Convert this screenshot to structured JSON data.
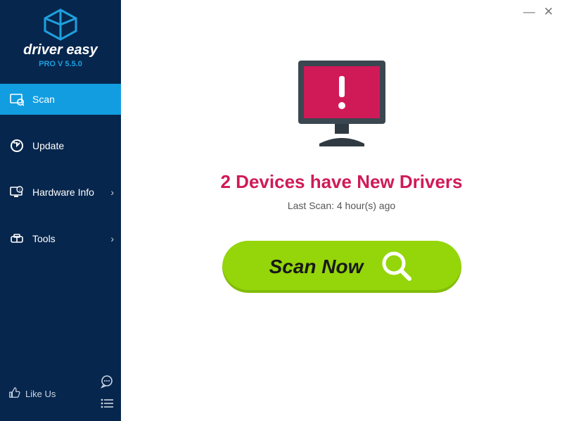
{
  "brand": {
    "name": "driver easy",
    "version": "PRO V 5.5.0"
  },
  "sidebar": {
    "items": [
      {
        "label": "Scan"
      },
      {
        "label": "Update"
      },
      {
        "label": "Hardware Info"
      },
      {
        "label": "Tools"
      }
    ],
    "like_us": "Like Us"
  },
  "titlebar": {
    "minimize": "—",
    "close": "✕"
  },
  "main": {
    "headline": "2 Devices have New Drivers",
    "last_scan": "Last Scan: 4 hour(s) ago",
    "scan_button": "Scan Now"
  }
}
